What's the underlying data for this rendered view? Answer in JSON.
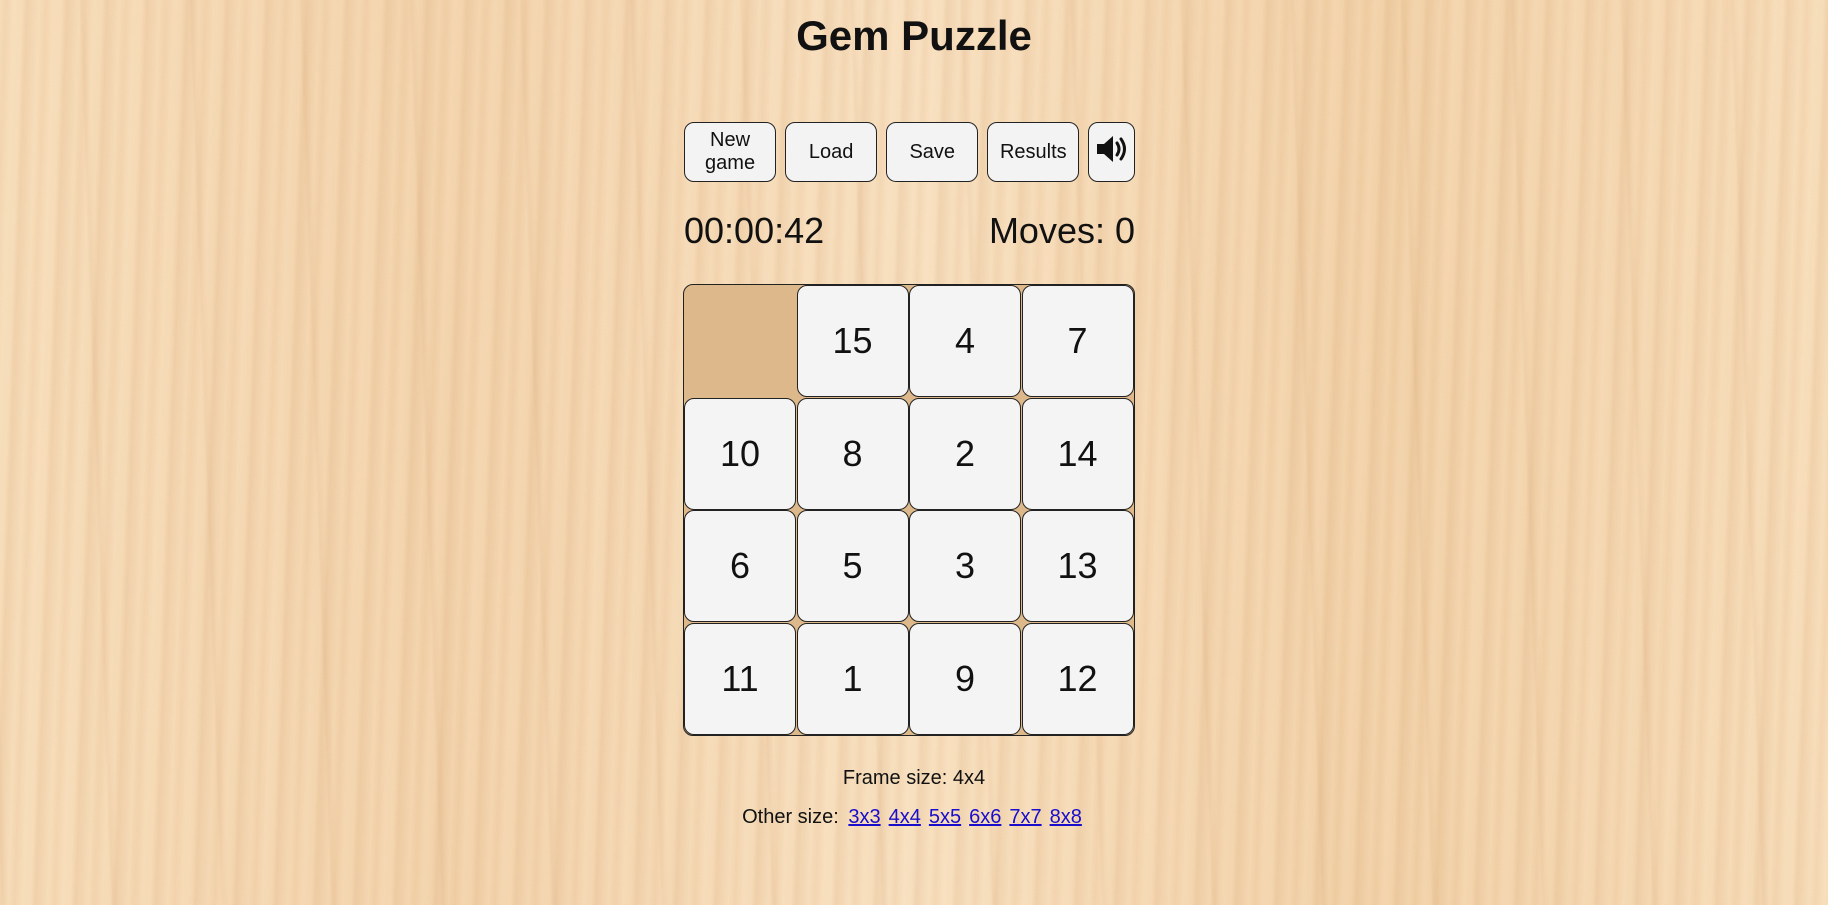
{
  "title": "Gem Puzzle",
  "toolbar": {
    "new_game_line1": "New",
    "new_game_line2": "game",
    "load": "Load",
    "save": "Save",
    "results": "Results",
    "sound_icon": "speaker-volume-icon"
  },
  "status": {
    "timer": "00:00:42",
    "moves": "Moves: 0"
  },
  "board": {
    "size": 4,
    "tiles": [
      [
        null,
        "15",
        "4",
        "7"
      ],
      [
        "10",
        "8",
        "2",
        "14"
      ],
      [
        "6",
        "5",
        "3",
        "13"
      ],
      [
        "11",
        "1",
        "9",
        "12"
      ]
    ]
  },
  "footer": {
    "frame_size": "Frame size: 4x4",
    "other_size_label": "Other size:",
    "sizes": [
      "3x3",
      "4x4",
      "5x5",
      "6x6",
      "7x7",
      "8x8"
    ]
  }
}
